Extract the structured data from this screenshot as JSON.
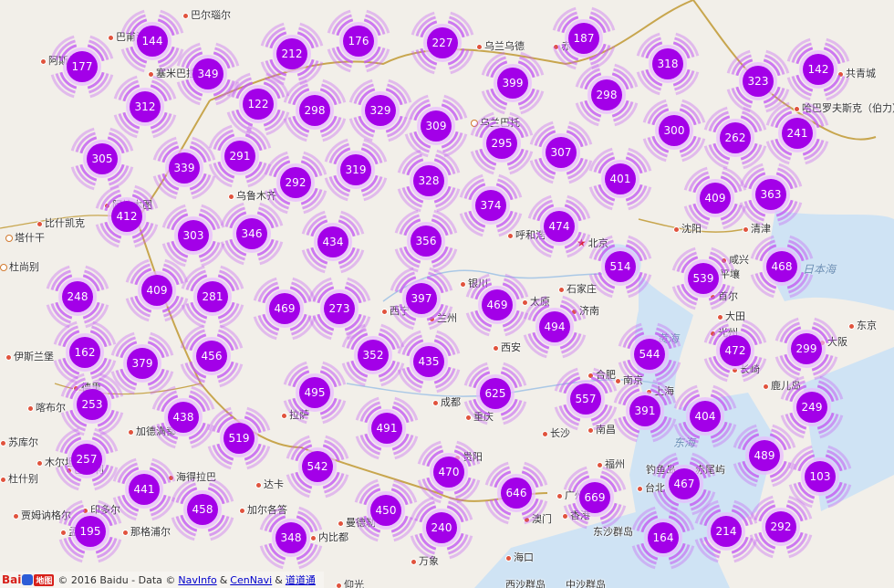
{
  "colors": {
    "land": "#f2efe9",
    "sea": "#cfe3f4",
    "border": "#c8a64e",
    "cluster_core": "#a300e8",
    "cluster_ring": "#c35af3",
    "cluster_halo": "#e8b8ff"
  },
  "cities": [
    {
      "name": "巴尔瑙尔",
      "marker": "dot"
    },
    {
      "name": "巴甫洛",
      "marker": "dot"
    },
    {
      "name": "阿斯塔",
      "marker": "dot"
    },
    {
      "name": "塞米巴拉",
      "marker": "dot"
    },
    {
      "name": "乌兰乌德",
      "marker": "dot"
    },
    {
      "name": "赤塔",
      "marker": "dot"
    },
    {
      "name": "共青城",
      "marker": "dot"
    },
    {
      "name": "哈巴罗夫斯克（伯力）",
      "marker": "dot"
    },
    {
      "name": "乌兰巴托",
      "marker": "ring"
    },
    {
      "name": "乌鲁木齐",
      "marker": "dot"
    },
    {
      "name": "阿拉木图",
      "marker": "dot"
    },
    {
      "name": "比什凯克",
      "marker": "dot"
    },
    {
      "name": "塔什干",
      "marker": "ring"
    },
    {
      "name": "呼和浩",
      "marker": "dot"
    },
    {
      "name": "北京",
      "marker": "star"
    },
    {
      "name": "沈阳",
      "marker": "dot"
    },
    {
      "name": "清津",
      "marker": "dot"
    },
    {
      "name": "咸兴",
      "marker": "dot"
    },
    {
      "name": "平壤",
      "marker": "dot"
    },
    {
      "name": "首尔",
      "marker": "dot"
    },
    {
      "name": "大田",
      "marker": "dot"
    },
    {
      "name": "光州",
      "marker": "dot"
    },
    {
      "name": "银川",
      "marker": "dot"
    },
    {
      "name": "太原",
      "marker": "dot"
    },
    {
      "name": "石家庄",
      "marker": "dot"
    },
    {
      "name": "济南",
      "marker": "dot"
    },
    {
      "name": "西宁",
      "marker": "dot"
    },
    {
      "name": "兰州",
      "marker": "dot"
    },
    {
      "name": "西安",
      "marker": "dot"
    },
    {
      "name": "成都",
      "marker": "dot"
    },
    {
      "name": "重庆",
      "marker": "dot"
    },
    {
      "name": "合肥",
      "marker": "dot"
    },
    {
      "name": "南京",
      "marker": "dot"
    },
    {
      "name": "上海",
      "marker": "dot"
    },
    {
      "name": "长沙",
      "marker": "dot"
    },
    {
      "name": "南昌",
      "marker": "dot"
    },
    {
      "name": "福州",
      "marker": "dot"
    },
    {
      "name": "台北",
      "marker": "dot"
    },
    {
      "name": "贵阳",
      "marker": "dot"
    },
    {
      "name": "广州",
      "marker": "dot"
    },
    {
      "name": "澳门",
      "marker": "dot"
    },
    {
      "name": "香港",
      "marker": "dot"
    },
    {
      "name": "海口",
      "marker": "dot"
    },
    {
      "name": "拉萨",
      "marker": "dot"
    },
    {
      "name": "杜尚别",
      "marker": "ring"
    },
    {
      "name": "喀布尔",
      "marker": "dot"
    },
    {
      "name": "伊斯兰堡",
      "marker": "dot"
    },
    {
      "name": "德里",
      "marker": "dot"
    },
    {
      "name": "加德满都",
      "marker": "dot"
    },
    {
      "name": "达卡",
      "marker": "dot"
    },
    {
      "name": "加尔各答",
      "marker": "dot"
    },
    {
      "name": "曼德勒",
      "marker": "dot"
    },
    {
      "name": "内比都",
      "marker": "dot"
    },
    {
      "name": "万象",
      "marker": "dot"
    },
    {
      "name": "仰光",
      "marker": "dot"
    },
    {
      "name": "苏库尔",
      "marker": "dot"
    },
    {
      "name": "木尔坦",
      "marker": "dot"
    },
    {
      "name": "巴雷利",
      "marker": "dot"
    },
    {
      "name": "印多尔",
      "marker": "dot"
    },
    {
      "name": "孟买",
      "marker": "dot"
    },
    {
      "name": "那格浦尔",
      "marker": "dot"
    },
    {
      "name": "海得拉巴",
      "marker": "dot"
    },
    {
      "name": "贾姆讷格尔",
      "marker": "dot"
    },
    {
      "name": "长崎",
      "marker": "dot"
    },
    {
      "name": "鹿儿岛",
      "marker": "dot"
    },
    {
      "name": "大阪",
      "marker": "dot"
    },
    {
      "name": "东京",
      "marker": "dot"
    },
    {
      "name": "西沙群岛",
      "marker": "none"
    },
    {
      "name": "中沙群岛",
      "marker": "none"
    },
    {
      "name": "东沙群岛",
      "marker": "none"
    },
    {
      "name": "钓鱼岛",
      "marker": "none"
    },
    {
      "name": "赤尾屿",
      "marker": "none"
    },
    {
      "name": "杜什别",
      "marker": "dot"
    }
  ],
  "seas": [
    "黄海",
    "东海",
    "日本海"
  ],
  "clusters": [
    177,
    144,
    349,
    212,
    176,
    227,
    187,
    318,
    142,
    312,
    122,
    298,
    329,
    309,
    399,
    298,
    323,
    305,
    339,
    291,
    292,
    319,
    328,
    295,
    307,
    300,
    262,
    241,
    412,
    303,
    346,
    434,
    356,
    374,
    474,
    401,
    409,
    363,
    248,
    409,
    281,
    469,
    273,
    397,
    469,
    494,
    514,
    539,
    468,
    162,
    379,
    456,
    352,
    435,
    544,
    472,
    299,
    253,
    438,
    495,
    625,
    557,
    391,
    404,
    249,
    257,
    519,
    491,
    542,
    470,
    489,
    103,
    441,
    458,
    646,
    669,
    467,
    195,
    348,
    450,
    240,
    164,
    214,
    292
  ],
  "footer": {
    "logo_text": "Bai",
    "logo_map": "地图",
    "copyright": "© 2016 Baidu - Data ©",
    "link1": "NavInfo",
    "amp1": "&",
    "link2": "CenNavi",
    "amp2": "&",
    "link3": "道道通"
  }
}
